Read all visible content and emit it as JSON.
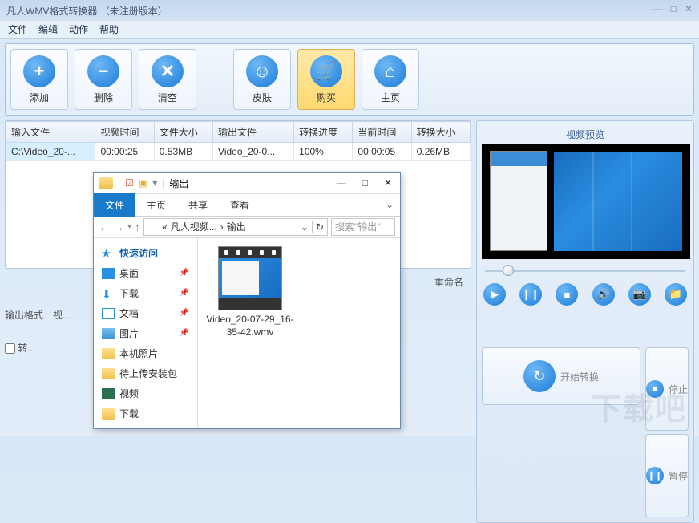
{
  "titlebar": {
    "title": "凡人WMV格式转换器  （未注册版本）"
  },
  "menu": {
    "file": "文件",
    "edit": "编辑",
    "action": "动作",
    "help": "帮助"
  },
  "toolbar": {
    "add": "添加",
    "delete": "删除",
    "clear": "清空",
    "skin": "皮肤",
    "buy": "购买",
    "home": "主页"
  },
  "table": {
    "headers": {
      "input": "输入文件",
      "vtime": "视频时间",
      "fsize": "文件大小",
      "output": "输出文件",
      "progress": "转换进度",
      "curtime": "当前时间",
      "csize": "转换大小"
    },
    "row": {
      "input": "C:\\Video_20-...",
      "vtime": "00:00:25",
      "fsize": "0.53MB",
      "output": "Video_20-0...",
      "progress": "100%",
      "curtime": "00:00:05",
      "csize": "0.26MB"
    }
  },
  "bottom": {
    "rename": "重命名",
    "format_label": "输出格式",
    "v1": "视...",
    "conv": "转..."
  },
  "preview": {
    "title": "视频预览"
  },
  "actions": {
    "start": "开始转换",
    "stop": "停止",
    "pause": "暂停"
  },
  "explorer": {
    "title": "输出",
    "ribbon": {
      "file": "文件",
      "home": "主页",
      "share": "共享",
      "view": "查看"
    },
    "path": {
      "p1": "凡人视频...",
      "p2": "输出"
    },
    "search": "搜索\"输出\"",
    "side": {
      "quick": "快速访问",
      "desktop": "桌面",
      "downloads": "下载",
      "docs": "文档",
      "pics": "图片",
      "localpics": "本机照片",
      "pending": "待上传安装包",
      "video": "视频",
      "downloads2": "下载"
    },
    "file": {
      "name": "Video_20-07-29_16-35-42.wmv"
    }
  },
  "watermark": "下载吧"
}
